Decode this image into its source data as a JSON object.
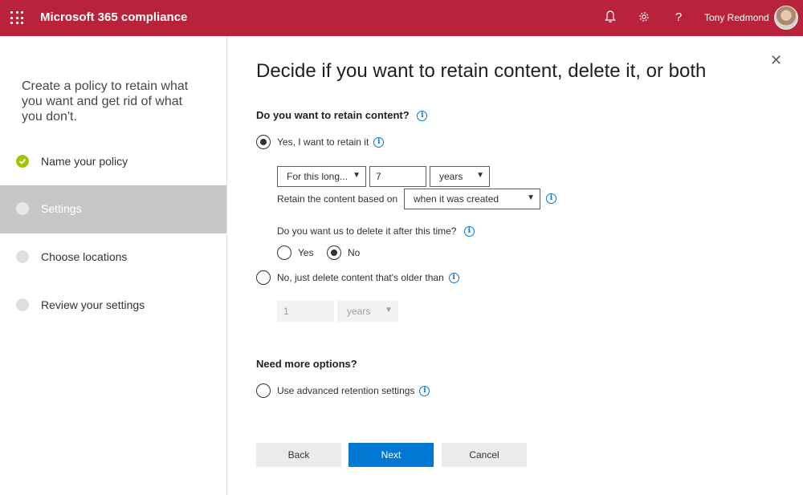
{
  "header": {
    "app_title": "Microsoft 365 compliance",
    "user_name": "Tony Redmond",
    "icons": [
      "waffle-icon",
      "bell-icon",
      "gear-icon",
      "help-icon"
    ]
  },
  "wizard": {
    "intro": "Create a policy to retain what you want and get rid of what you don't.",
    "steps": [
      {
        "label": "Name your policy",
        "state": "done"
      },
      {
        "label": "Settings",
        "state": "active"
      },
      {
        "label": "Choose locations",
        "state": "pending"
      },
      {
        "label": "Review your settings",
        "state": "pending"
      }
    ]
  },
  "main": {
    "title": "Decide if you want to retain content, delete it, or both",
    "retain_question": "Do you want to retain content?",
    "retain_option": "Yes, I want to retain it",
    "period_select": "For this long...",
    "period_value": "7",
    "period_unit": "years",
    "based_on_label": "Retain the content based on",
    "based_on_value": "when it was created",
    "delete_question": "Do you want us to delete it after this time?",
    "delete_yes": "Yes",
    "delete_no": "No",
    "delete_only_option": "No, just delete content that's older than",
    "delete_only_value": "1",
    "delete_only_unit": "years",
    "more_options_heading": "Need more options?",
    "advanced_option": "Use advanced retention settings",
    "buttons": {
      "back": "Back",
      "next": "Next",
      "cancel": "Cancel"
    }
  },
  "colors": {
    "header": "#b8223a",
    "primary": "#0078d4",
    "done": "#a4c400"
  }
}
